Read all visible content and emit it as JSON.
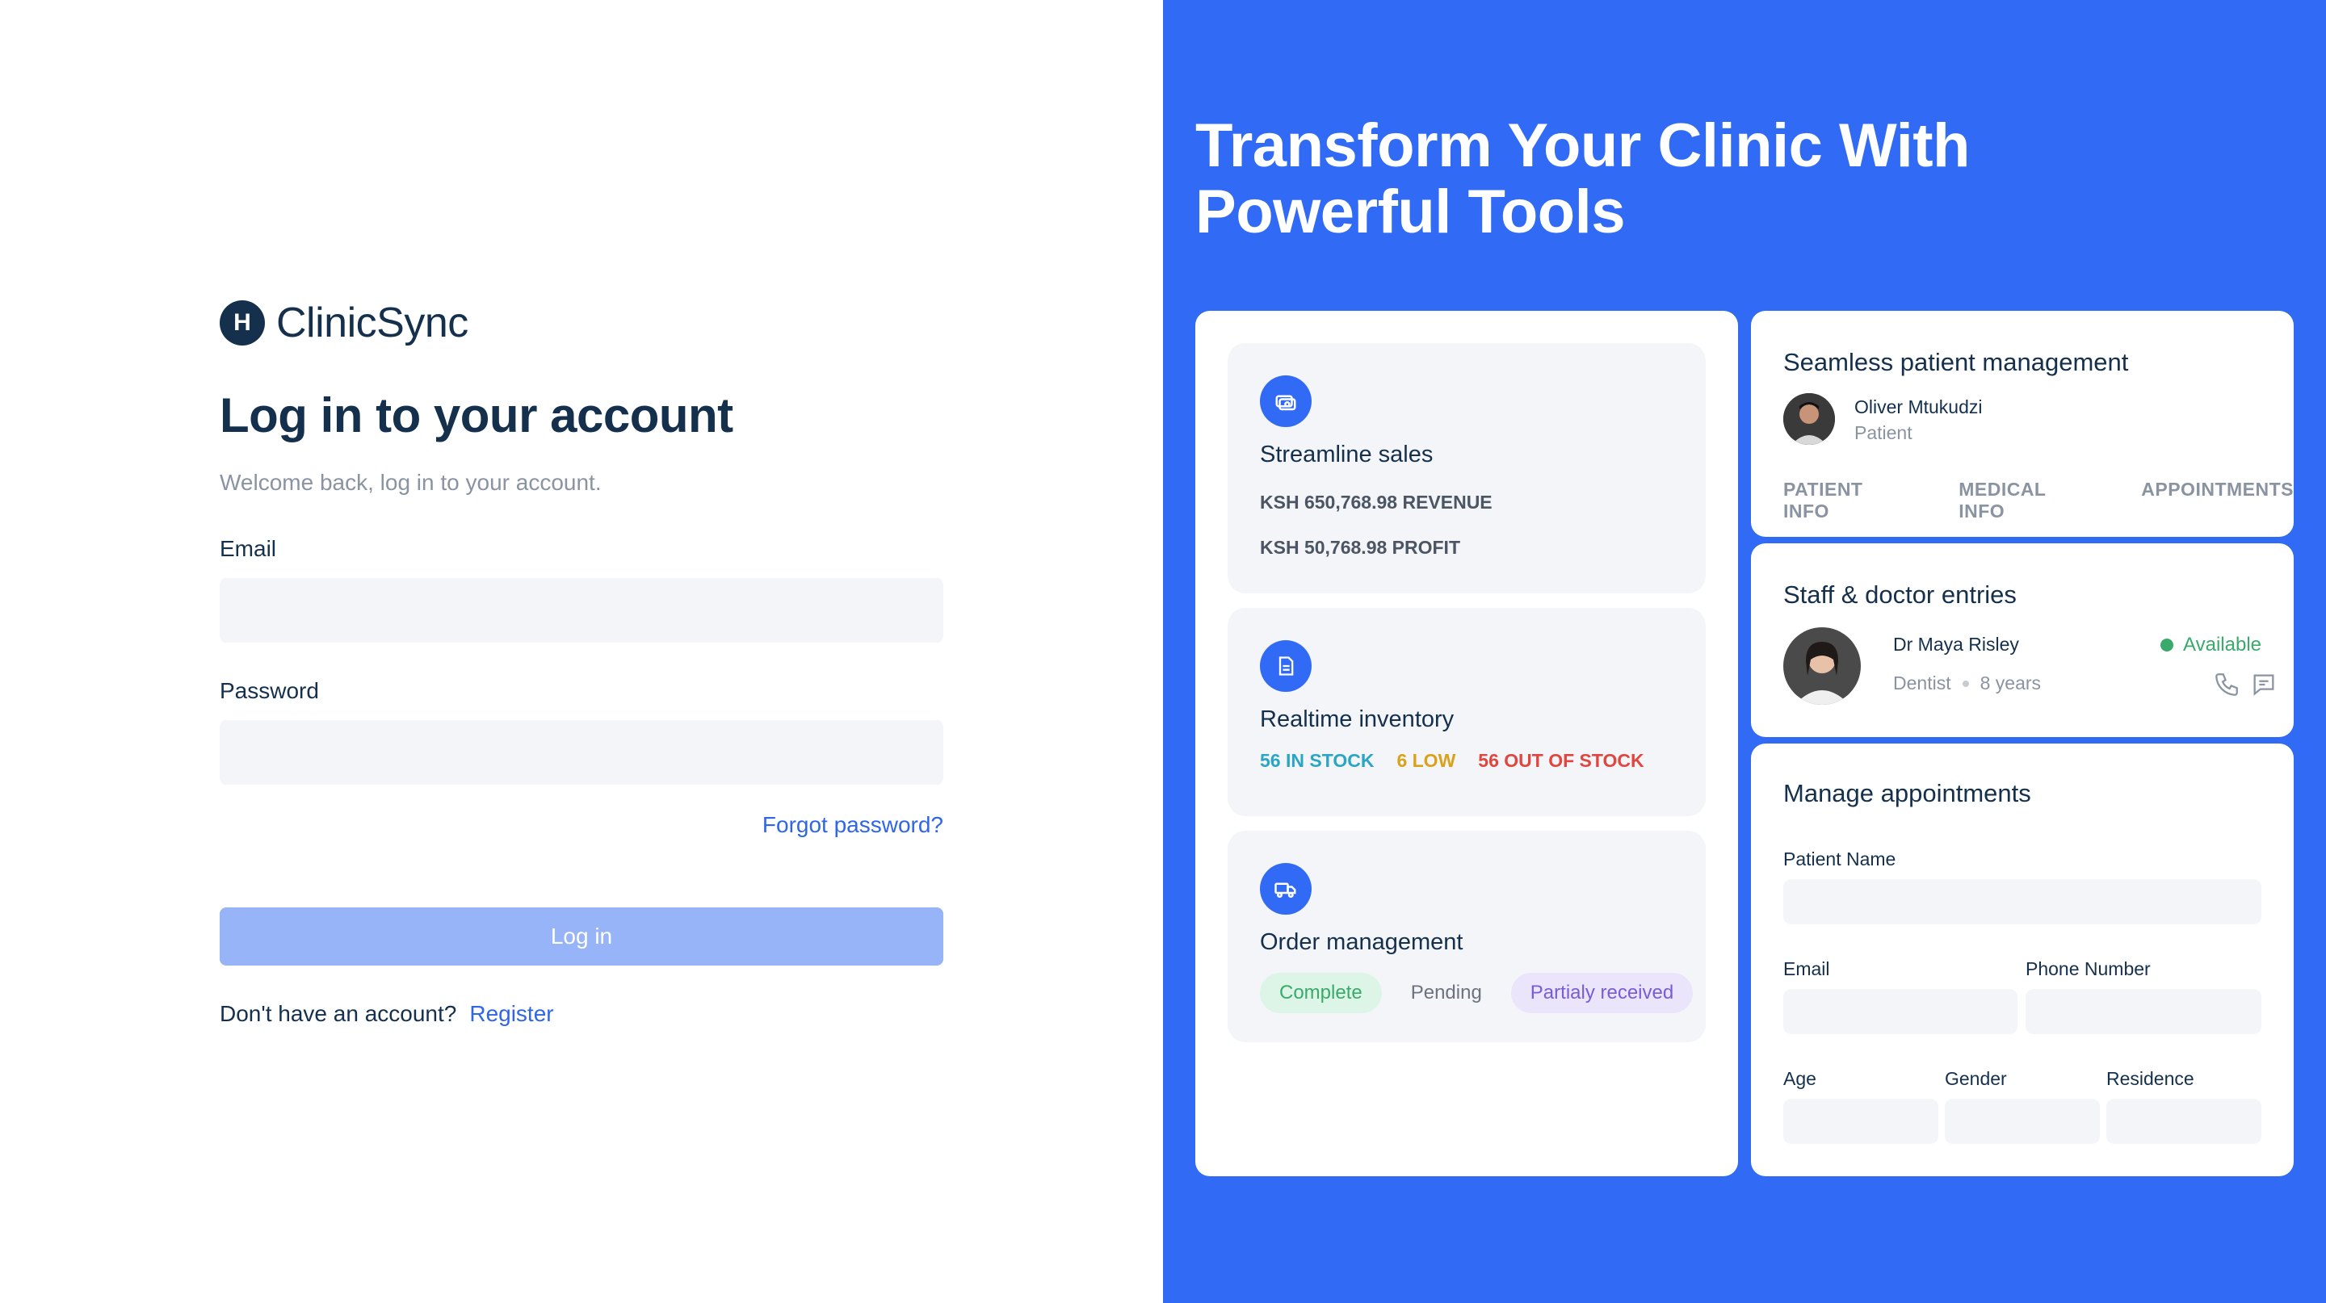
{
  "brand": {
    "logo_letter": "H",
    "name": "ClinicSync"
  },
  "login": {
    "title": "Log in to your account",
    "subtitle": "Welcome back, log in to your account.",
    "email_label": "Email",
    "email_value": "",
    "password_label": "Password",
    "password_value": "",
    "forgot_label": "Forgot password?",
    "submit_label": "Log in",
    "no_account_text": "Don't have an account?",
    "register_label": "Register"
  },
  "hero": {
    "line1": "Transform Your Clinic With",
    "line2": "Powerful Tools"
  },
  "features": {
    "sales": {
      "icon": "money-icon",
      "title": "Streamline sales",
      "revenue": "KSH 650,768.98 REVENUE",
      "profit": "KSH 50,768.98 PROFIT"
    },
    "inventory": {
      "icon": "document-icon",
      "title": "Realtime inventory",
      "in_stock": "56 IN STOCK",
      "low": "6 LOW",
      "out_of_stock": "56 OUT OF STOCK"
    },
    "orders": {
      "icon": "truck-icon",
      "title": "Order management",
      "complete": "Complete",
      "pending": "Pending",
      "partial": "Partialy received"
    }
  },
  "patients": {
    "title": "Seamless patient management",
    "name": "Oliver Mtukudzi",
    "role": "Patient",
    "tabs": [
      "PATIENT INFO",
      "MEDICAL INFO",
      "APPOINTMENTS"
    ]
  },
  "staff": {
    "title": "Staff & doctor entries",
    "name": "Dr Maya Risley",
    "specialty": "Dentist",
    "experience": "8 years",
    "status": "Available"
  },
  "appointments": {
    "title": "Manage appointments",
    "patient_name_label": "Patient Name",
    "email_label": "Email",
    "phone_label": "Phone Number",
    "age_label": "Age",
    "gender_label": "Gender",
    "residence_label": "Residence"
  },
  "colors": {
    "primary": "#316bf5",
    "navy": "#14304d",
    "muted": "#8a93a1",
    "in_stock": "#2aa6c4",
    "low": "#d9a21a",
    "out_of_stock": "#e0463f",
    "available": "#3aaa6b"
  }
}
